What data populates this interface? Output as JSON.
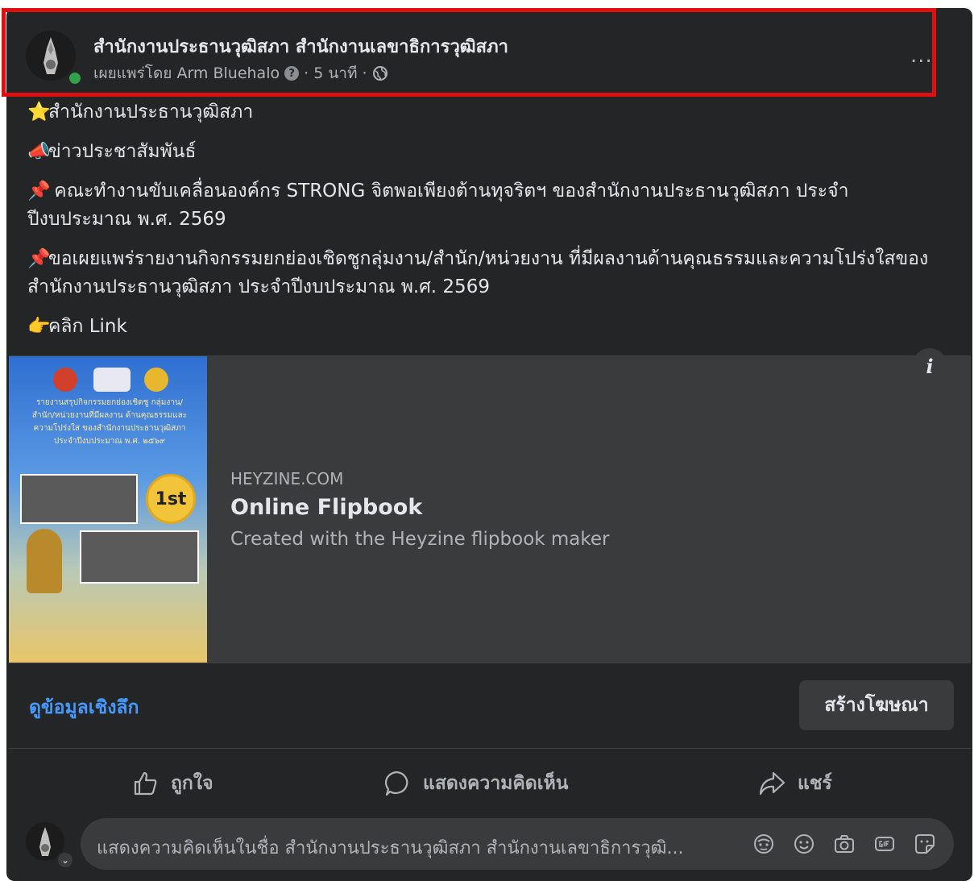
{
  "post": {
    "page_name": "สำนักงานประธานวุฒิสภา สำนักงานเลขาธิการวุฒิสภา",
    "meta_prefix": "เผยแพร่โดย Arm Bluehalo",
    "meta_help_icon": "?",
    "meta_time": "· 5 นาที ·",
    "more_label": "...",
    "lines": [
      {
        "icon": "⭐",
        "text": "สำนักงานประธานวุฒิสภา"
      },
      {
        "icon": "📣",
        "text": "ข่าวประชาสัมพันธ์"
      },
      {
        "icon": "📌",
        "text": " คณะทำงานขับเคลื่อนองค์กร STRONG จิตพอเพียงต้านทุจริตฯ ของสำนักงานประธานวุฒิสภา ประจำปีงบประมาณ พ.ศ. 2569"
      },
      {
        "icon": "📌",
        "text": "ขอเผยแพร่รายงานกิจกรรมยกย่องเชิดชูกลุ่มงาน/สำนัก/หน่วยงาน ที่มีผลงานด้านคุณธรรมและความโปร่งใสของสำนักงานประธานวุฒิสภา ประจำปีงบประมาณ พ.ศ. 2569"
      },
      {
        "icon": "👉",
        "text": "คลิก Link"
      }
    ]
  },
  "link_preview": {
    "domain": "HEYZINE.COM",
    "title": "Online Flipbook",
    "description": "Created with the Heyzine flipbook maker",
    "info_label": "i",
    "thumb_text": "รายงานสรุปกิจกรรมยกย่องเชิดชู กลุ่มงาน/สำนัก/หน่วยงานที่มีผลงาน ด้านคุณธรรมและความโปร่งใส ของสำนักงานประธานวุฒิสภา ประจำปีงบประมาณ พ.ศ. ๒๕๖๙",
    "thumb_medal": "1st"
  },
  "insights_label": "ดูข้อมูลเชิงลึก",
  "boost_label": "สร้างโฆษณา",
  "actions": {
    "like": "ถูกใจ",
    "comment": "แสดงความคิดเห็น",
    "share": "แชร์"
  },
  "comment_box": {
    "placeholder": "แสดงความคิดเห็นในชื่อ สำนักงานประธานวุฒิสภา สำนักงานเลขาธิการวุฒิ..."
  },
  "colors": {
    "card_bg": "#242526",
    "highlight": "#e01010",
    "link_blue": "#4599ff",
    "online": "#31a24c"
  }
}
